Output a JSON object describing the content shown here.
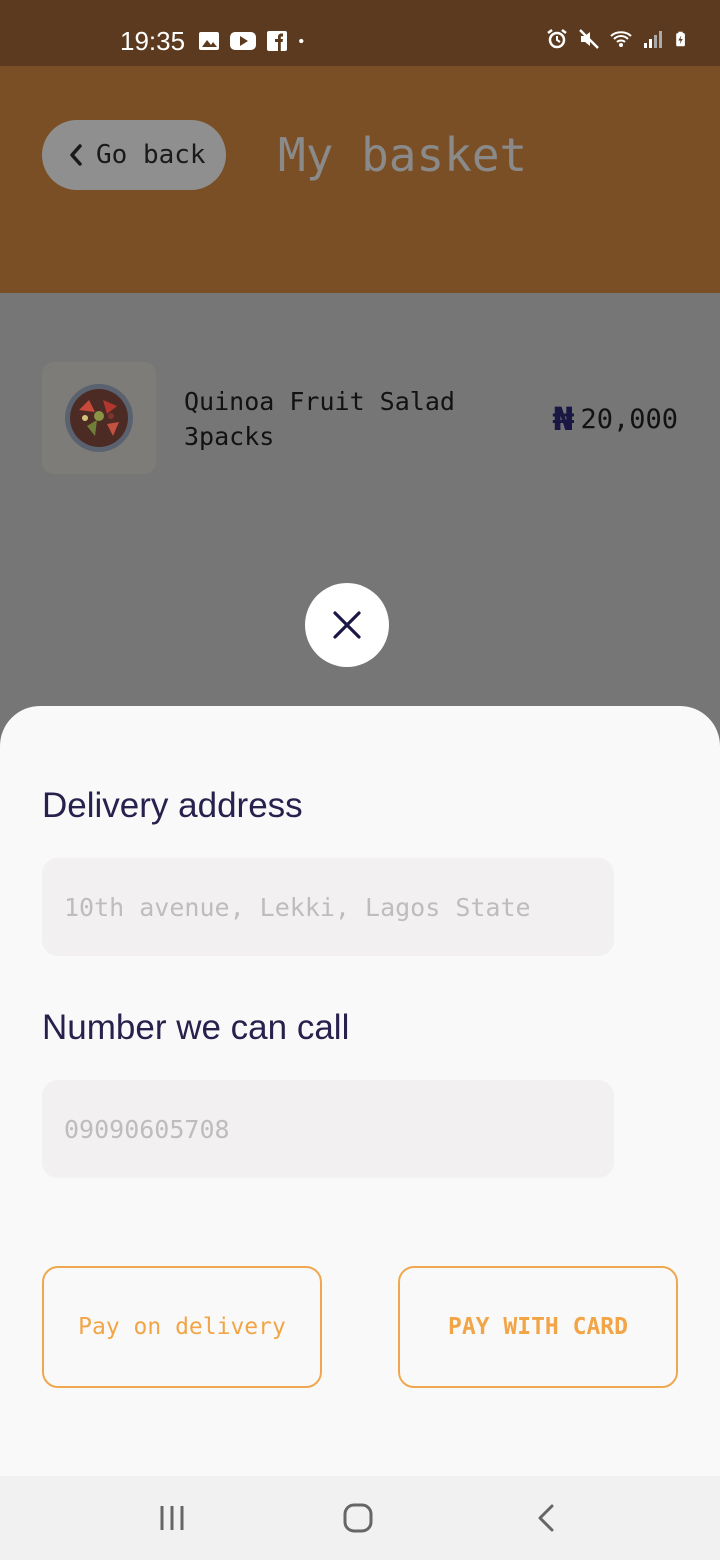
{
  "status_bar": {
    "time": "19:35",
    "left_icons": [
      "gallery-icon",
      "youtube-icon",
      "facebook-icon",
      "dot-icon"
    ],
    "right_icons": [
      "alarm-icon",
      "mute-icon",
      "wifi-icon",
      "signal-icon",
      "battery-icon"
    ]
  },
  "header": {
    "back_label": "Go back",
    "title": "My basket"
  },
  "basket": {
    "items": [
      {
        "name": "Quinoa Fruit Salad",
        "quantity": "3packs",
        "currency_symbol": "₦",
        "price": "20,000"
      }
    ]
  },
  "sheet": {
    "address_label": "Delivery address",
    "address_placeholder": "10th avenue, Lekki, Lagos State",
    "phone_label": "Number we can call",
    "phone_placeholder": "09090605708",
    "pay_on_delivery_label": "Pay on delivery",
    "pay_with_card_label": "PAY WITH CARD"
  },
  "colors": {
    "accent": "#f2a547",
    "header_bg": "#7a4f25",
    "status_bar_bg": "#5c3a1f",
    "label_text": "#27214d",
    "overlay": "#767676"
  }
}
